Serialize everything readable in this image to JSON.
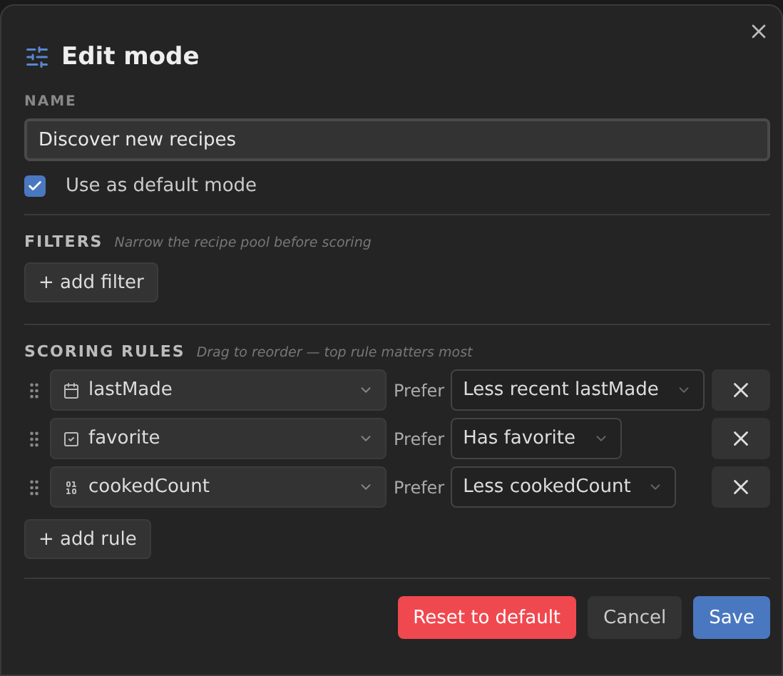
{
  "title": "Edit mode",
  "name_field": {
    "label": "NAME",
    "value": "Discover new recipes"
  },
  "default_checkbox": {
    "label": "Use as default mode",
    "checked": true
  },
  "filters": {
    "heading": "FILTERS",
    "hint": "Narrow the recipe pool before scoring",
    "add_button": "+ add filter"
  },
  "scoring": {
    "heading": "SCORING RULES",
    "hint": "Drag to reorder — top rule matters most",
    "add_button": "+ add rule",
    "rules": [
      {
        "kind": "date",
        "field": "lastMade",
        "prefer_label": "Prefer",
        "direction": "Less recent lastMade"
      },
      {
        "kind": "boolean",
        "field": "favorite",
        "prefer_label": "Prefer",
        "direction": "Has favorite"
      },
      {
        "kind": "number",
        "field": "cookedCount",
        "prefer_label": "Prefer",
        "direction": "Less cookedCount"
      }
    ]
  },
  "buttons": [
    {
      "kind": "danger",
      "label": "Reset to default"
    },
    {
      "kind": "neutral",
      "label": "Cancel"
    },
    {
      "kind": "primary",
      "label": "Save"
    }
  ]
}
